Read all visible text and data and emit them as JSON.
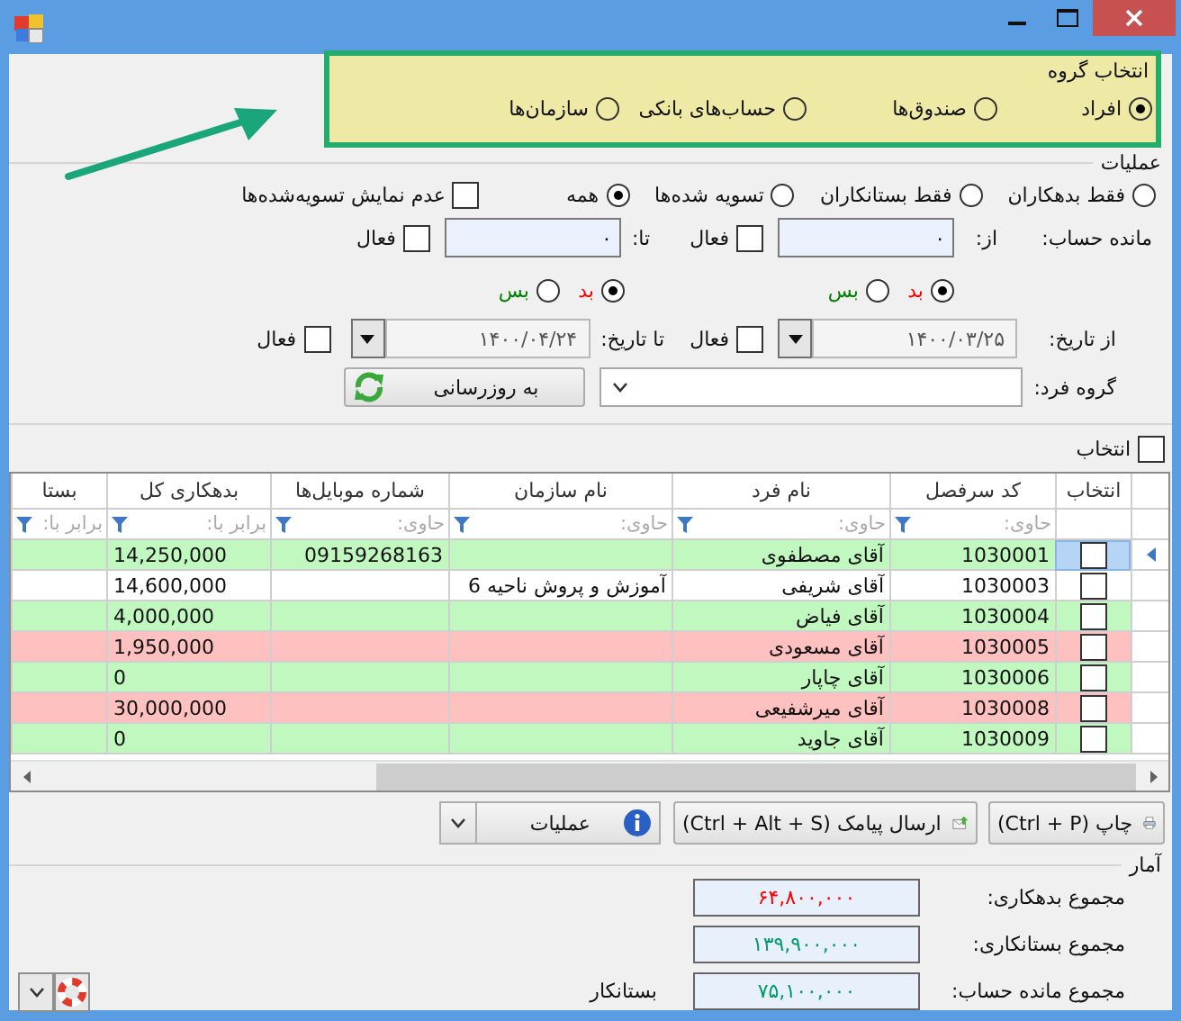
{
  "group_select": {
    "title": "انتخاب گروه",
    "options": [
      {
        "label": "افراد",
        "selected": true
      },
      {
        "label": "صندوق‌ها",
        "selected": false
      },
      {
        "label": "حساب‌های بانکی",
        "selected": false
      },
      {
        "label": "سازمان‌ها",
        "selected": false
      }
    ]
  },
  "operations": {
    "title": "عملیات",
    "filters": [
      {
        "label": "فقط بدهکاران",
        "selected": false
      },
      {
        "label": "فقط بستانکاران",
        "selected": false
      },
      {
        "label": "تسویه شده‌ها",
        "selected": false
      },
      {
        "label": "همه",
        "selected": true
      }
    ],
    "hide_settled": {
      "label": "عدم نمایش تسویه‌شده‌ها",
      "checked": false
    },
    "balance": {
      "label": "مانده حساب:",
      "ranges": [
        {
          "label": "از:",
          "value": "۰",
          "active": {
            "label": "فعال",
            "checked": false
          },
          "sides": [
            {
              "label": "بد",
              "selected": true,
              "color": "#ff0000"
            },
            {
              "label": "بس",
              "selected": false,
              "color": "#008000"
            }
          ]
        },
        {
          "label": "تا:",
          "value": "۰",
          "active": {
            "label": "فعال",
            "checked": false
          },
          "sides": [
            {
              "label": "بد",
              "selected": true,
              "color": "#ff0000"
            },
            {
              "label": "بس",
              "selected": false,
              "color": "#008000"
            }
          ]
        }
      ]
    },
    "dates": {
      "ranges": [
        {
          "label": "از تاریخ:",
          "value": "۱۴۰۰/۰۳/۲۵",
          "active": {
            "label": "فعال",
            "checked": false
          }
        },
        {
          "label": "تا تاریخ:",
          "value": "۱۴۰۰/۰۴/۲۴",
          "active": {
            "label": "فعال",
            "checked": false
          }
        }
      ]
    },
    "person_group": {
      "label": "گروه فرد:"
    },
    "refresh_button": "به روزرسانی"
  },
  "select_all": {
    "label": "انتخاب",
    "checked": false
  },
  "table": {
    "columns": [
      {
        "title": "انتخاب"
      },
      {
        "title": "کد سرفصل",
        "filter": {
          "placeholder": "حاوی:"
        }
      },
      {
        "title": "نام فرد",
        "filter": {
          "placeholder": "حاوی:"
        }
      },
      {
        "title": "نام سازمان",
        "filter": {
          "placeholder": "حاوی:"
        }
      },
      {
        "title": "شماره موبایل‌ها",
        "filter": {
          "placeholder": "حاوی:"
        }
      },
      {
        "title": "بدهکاری کل",
        "filter": {
          "placeholder": "برابر با:"
        }
      },
      {
        "title": "بستا",
        "filter": {
          "placeholder": "برابر با:"
        }
      }
    ],
    "rows": [
      {
        "selected": true,
        "checked": false,
        "code": "1030001",
        "name": "آقای مصطفوی",
        "mobile": "09159268163",
        "total_debt": "14,250,000",
        "color": "#c0f8c0"
      },
      {
        "selected": false,
        "checked": false,
        "code": "1030003",
        "name": "آقای شریفی",
        "organization": "آموزش و پروش ناحیه 6",
        "total_debt": "14,600,000",
        "color": "#ffffff"
      },
      {
        "selected": false,
        "checked": false,
        "code": "1030004",
        "name": "آقای فیاض",
        "total_debt": "4,000,000",
        "color": "#c0f8c0"
      },
      {
        "selected": false,
        "checked": false,
        "code": "1030005",
        "name": "آقای مسعودی",
        "total_debt": "1,950,000",
        "color": "#ffc0c0"
      },
      {
        "selected": false,
        "checked": false,
        "code": "1030006",
        "name": "آقای چاپار",
        "total_debt": "0",
        "color": "#c0f8c0"
      },
      {
        "selected": false,
        "checked": false,
        "code": "1030008",
        "name": "آقای میرشفیعی",
        "total_debt": "30,000,000",
        "color": "#ffc0c0"
      },
      {
        "selected": false,
        "checked": false,
        "code": "1030009",
        "name": "آقای جاوید",
        "total_debt": "0",
        "color": "#c0f8c0"
      }
    ]
  },
  "toolbar": {
    "print": "چاپ (Ctrl + P)",
    "sms": "ارسال پیامک (Ctrl + Alt + S)",
    "operations": "عملیات"
  },
  "stats": {
    "title": "آمار",
    "rows": [
      {
        "label": "مجموع بدهکاری:",
        "value": "۶۴,۸۰۰,۰۰۰",
        "color": "#ff0000"
      },
      {
        "label": "مجموع بستانکاری:",
        "value": "۱۳۹,۹۰۰,۰۰۰",
        "color": "#009966"
      },
      {
        "label": "مجموع مانده حساب:",
        "value": "۷۵,۱۰۰,۰۰۰",
        "color": "#009966"
      }
    ],
    "balance_side": "بستانکار"
  }
}
